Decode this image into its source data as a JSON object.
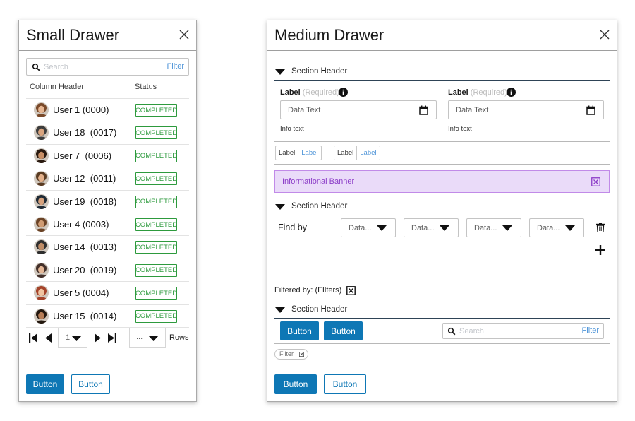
{
  "small_drawer": {
    "title": "Small Drawer",
    "search": {
      "placeholder": "Search",
      "filter_label": "Filter"
    },
    "columns": [
      "Column Header",
      "Status"
    ],
    "rows": [
      {
        "name": "User 1 (0000)",
        "status": "COMPLETED"
      },
      {
        "name": "User 18  (0017)",
        "status": "COMPLETED"
      },
      {
        "name": "User 7  (0006)",
        "status": "COMPLETED"
      },
      {
        "name": "User 12  (0011)",
        "status": "COMPLETED"
      },
      {
        "name": "User 19  (0018)",
        "status": "COMPLETED"
      },
      {
        "name": "User 4 (0003)",
        "status": "COMPLETED"
      },
      {
        "name": "User 14  (0013)",
        "status": "COMPLETED"
      },
      {
        "name": "User 20  (0019)",
        "status": "COMPLETED"
      },
      {
        "name": "User 5 (0004)",
        "status": "COMPLETED"
      },
      {
        "name": "User 15  (0014)",
        "status": "COMPLETED"
      }
    ],
    "pager": {
      "page": "1",
      "rows_value": "...",
      "rows_label": "Rows"
    },
    "footer": {
      "primary": "Button",
      "secondary": "Button"
    }
  },
  "medium_drawer": {
    "title": "Medium Drawer",
    "section1": "Section Header",
    "fields": [
      {
        "label": "Label",
        "required": "(Required)",
        "value": "Data Text",
        "helper": "Info text"
      },
      {
        "label": "Label",
        "required": "(Required)",
        "value": "Data Text",
        "helper": "Info text"
      }
    ],
    "toggles": [
      {
        "a": "Label",
        "b": "Label"
      },
      {
        "a": "Label",
        "b": "Label"
      }
    ],
    "banner": "Informational Banner",
    "section2": "Section Header",
    "find_by": "Find by",
    "dropdowns": [
      "Data...",
      "Data...",
      "Data...",
      "Data..."
    ],
    "filtered_by": "Filtered by: (FIlters)",
    "section3": "Section Header",
    "action_buttons": [
      "Button",
      "Button"
    ],
    "search": {
      "placeholder": "Search",
      "filter_label": "Filter"
    },
    "chip": "Filter",
    "footer": {
      "primary": "Button",
      "secondary": "Button"
    }
  },
  "colors": {
    "primary": "#0e77b5",
    "success": "#2d9a3d",
    "banner_bg": "#eadbf9",
    "banner_text": "#8c3dc8",
    "link": "#4f95d8"
  },
  "icons": [
    "close-icon",
    "search-icon",
    "user-avatar",
    "first-page-icon",
    "prev-page-icon",
    "next-page-icon",
    "last-page-icon",
    "caret-down-icon",
    "info-icon",
    "calendar-icon",
    "dismiss-icon",
    "trash-icon",
    "plus-icon"
  ]
}
